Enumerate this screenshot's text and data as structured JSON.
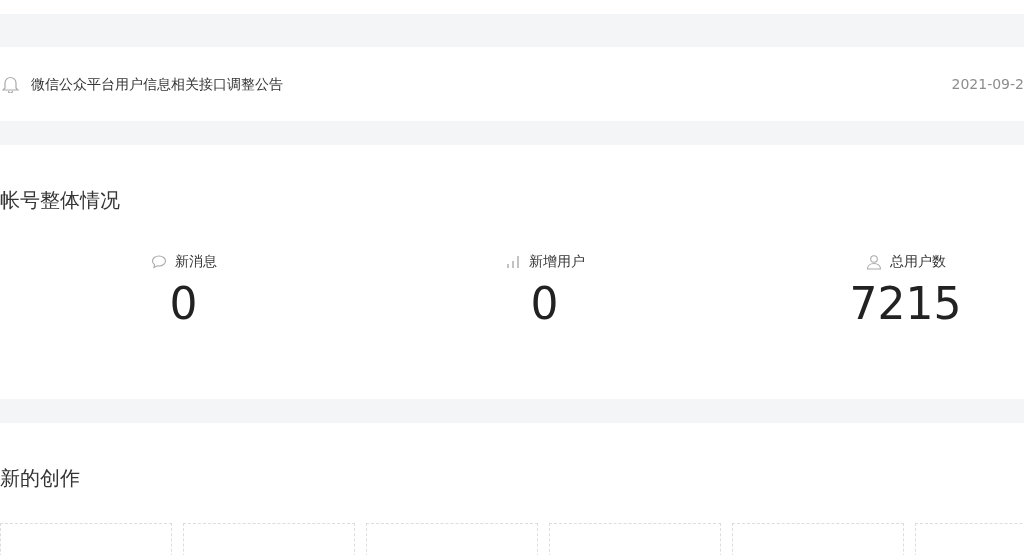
{
  "notice": {
    "title": "微信公众平台用户信息相关接口调整公告",
    "date": "2021-09-2"
  },
  "overview": {
    "title": "帐号整体情况",
    "stats": [
      {
        "kind": "message",
        "label": "新消息",
        "value": "0"
      },
      {
        "kind": "growth",
        "label": "新增用户",
        "value": "0"
      },
      {
        "kind": "users",
        "label": "总用户数",
        "value": "7215"
      }
    ]
  },
  "creations": {
    "title": "新的创作",
    "slots": [
      {
        "kind": "empty"
      },
      {
        "kind": "empty"
      },
      {
        "kind": "empty"
      },
      {
        "kind": "empty"
      },
      {
        "kind": "empty"
      },
      {
        "kind": "empty"
      }
    ]
  }
}
